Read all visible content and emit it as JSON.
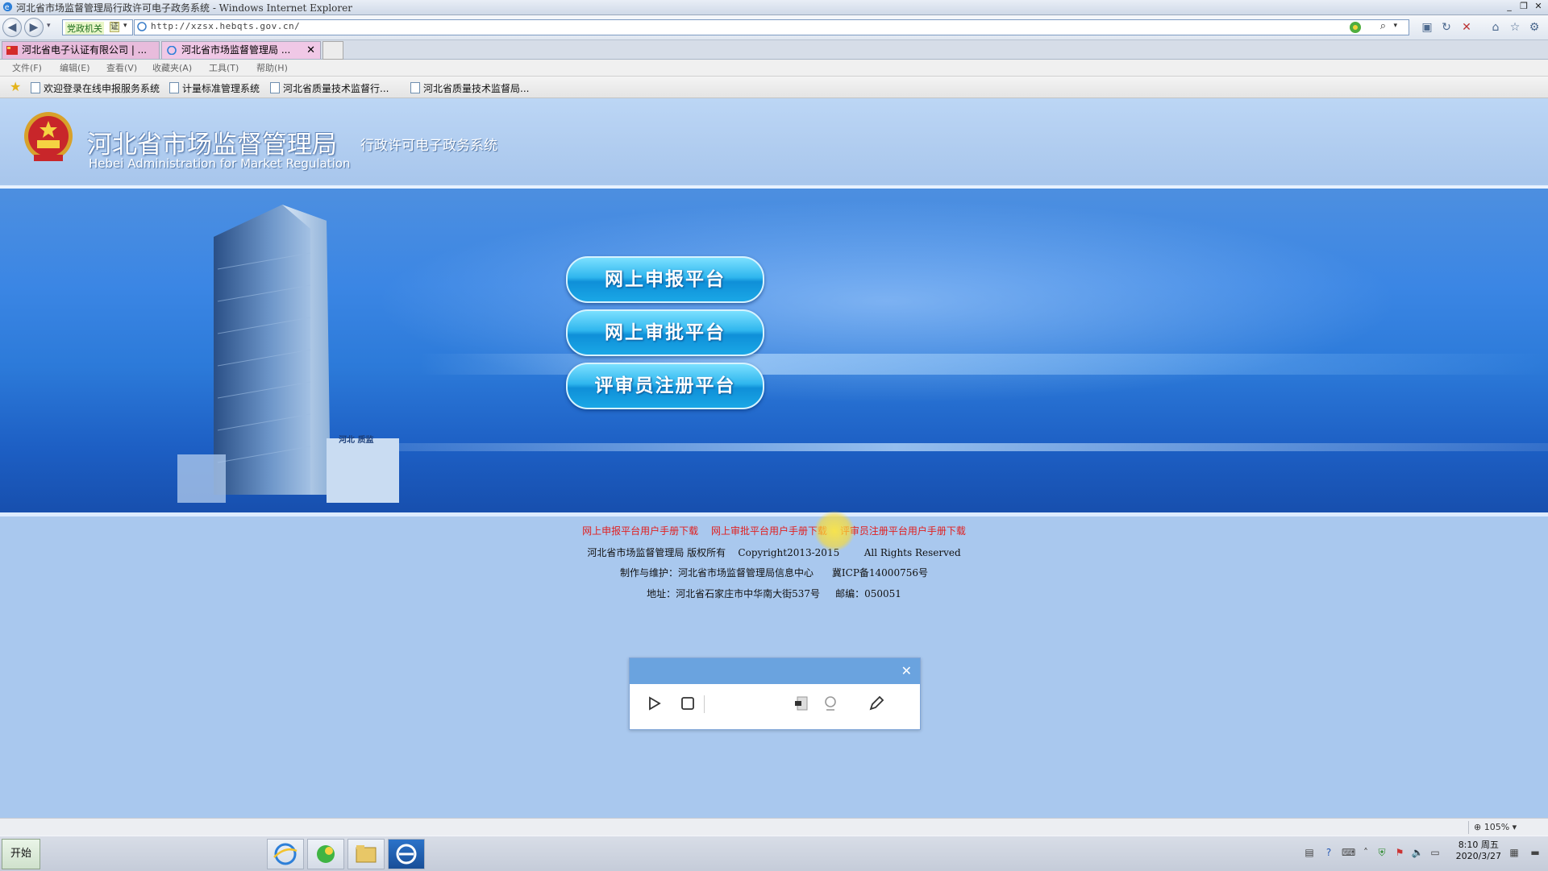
{
  "window": {
    "title": "河北省市场监督管理局行政许可电子政务系统 - Windows Internet Explorer",
    "controls": [
      "_",
      "❐",
      "✕"
    ]
  },
  "nav": {
    "gov_badge": "党政机关",
    "gov_badge_mark": "证",
    "url": "http://xzsx.hebqts.gov.cn/"
  },
  "tabs": [
    {
      "label": "河北省电子认证有限公司 | ..."
    },
    {
      "label": "河北省市场监督管理局 ...",
      "close": "✕"
    }
  ],
  "menu": [
    "文件(F)",
    "编辑(E)",
    "查看(V)",
    "收藏夹(A)",
    "工具(T)",
    "帮助(H)"
  ],
  "favorites": [
    "欢迎登录在线申报服务系统",
    "计量标准管理系统",
    "河北省质量技术监督行...",
    "河北省质量技术监督局..."
  ],
  "header": {
    "title": "河北省市场监督管理局",
    "subtitle": "Hebei Administration for Market Regulation",
    "tagline": "行政许可电子政务系统"
  },
  "banner": {
    "building_sign": "河北 质监",
    "buttons": [
      "网上申报平台",
      "网上审批平台",
      "评审员注册平台"
    ]
  },
  "footer": {
    "links": [
      "网上申报平台用户手册下载",
      "网上审批平台用户手册下载",
      "评审员注册平台用户手册下载"
    ],
    "copyright_owner": "河北省市场监督管理局 版权所有",
    "copyright_years": "Copyright2013-2015",
    "rights": "All Rights Reserved",
    "maintainer": "制作与维护：河北省市场监督管理局信息中心",
    "icp": "冀ICP备14000756号",
    "address": "地址：河北省石家庄市中华南大街537号",
    "postcode": "邮编：050051"
  },
  "recorder": {
    "close": "✕"
  },
  "status": {
    "zoom": "105%"
  },
  "taskbar": {
    "start": "开始",
    "clock_time": "8:10 周五",
    "clock_date": "2020/3/27"
  },
  "colors": {
    "page_bg": "#a9c8ee",
    "banner_blue": "#2c7ad9",
    "button_cyan": "#2fb6ee",
    "link_red": "#e02020"
  }
}
